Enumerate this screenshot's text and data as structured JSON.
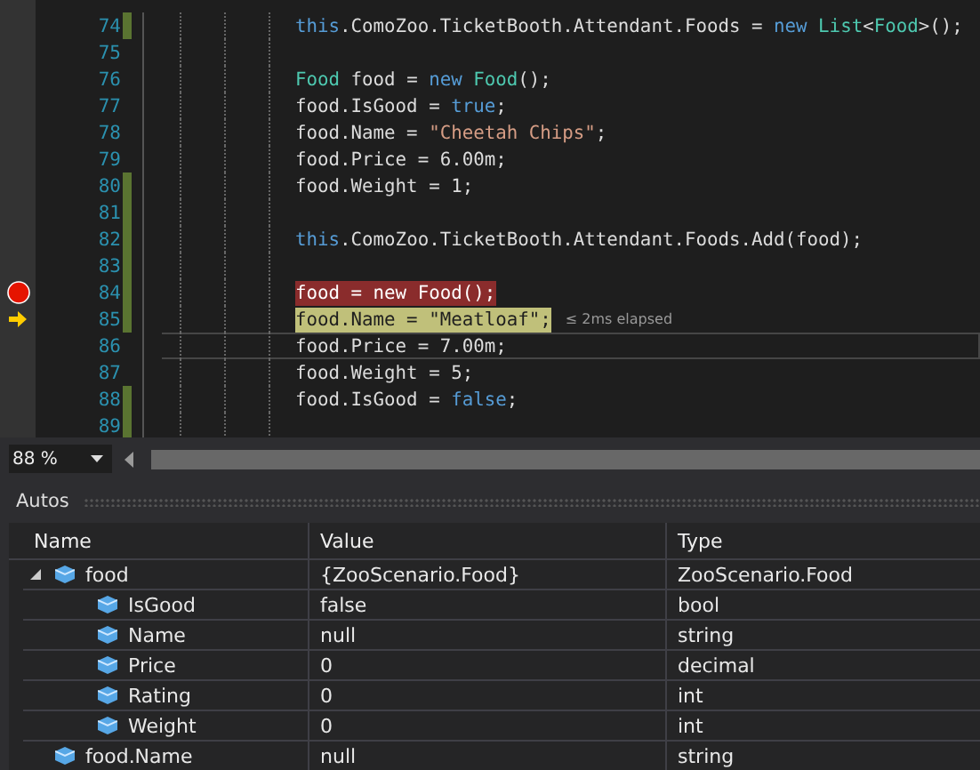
{
  "editor": {
    "lines": [
      {
        "number": "74",
        "changed": true,
        "kind": "normal",
        "tokens": [
          {
            "kind": "keyword",
            "text": "this"
          },
          {
            "kind": "plain",
            "text": ".ComoZoo.TicketBooth.Attendant.Foods = "
          },
          {
            "kind": "keyword",
            "text": "new"
          },
          {
            "kind": "type",
            "text": " List"
          },
          {
            "kind": "plain",
            "text": "<"
          },
          {
            "kind": "type",
            "text": "Food"
          },
          {
            "kind": "plain",
            "text": ">();"
          }
        ]
      },
      {
        "number": "75",
        "changed": false,
        "kind": "normal"
      },
      {
        "number": "76",
        "changed": false,
        "kind": "normal",
        "tokens": [
          {
            "kind": "type",
            "text": "Food"
          },
          {
            "kind": "plain",
            "text": " food = "
          },
          {
            "kind": "keyword",
            "text": "new"
          },
          {
            "kind": "type",
            "text": " Food"
          },
          {
            "kind": "plain",
            "text": "();"
          }
        ]
      },
      {
        "number": "77",
        "changed": false,
        "kind": "normal",
        "tokens": [
          {
            "kind": "plain",
            "text": "food.IsGood = "
          },
          {
            "kind": "keyword",
            "text": "true"
          },
          {
            "kind": "plain",
            "text": ";"
          }
        ]
      },
      {
        "number": "78",
        "changed": false,
        "kind": "normal",
        "tokens": [
          {
            "kind": "plain",
            "text": "food.Name = "
          },
          {
            "kind": "string",
            "text": "\"Cheetah Chips\""
          },
          {
            "kind": "plain",
            "text": ";"
          }
        ]
      },
      {
        "number": "79",
        "changed": false,
        "kind": "normal",
        "tokens": [
          {
            "kind": "plain",
            "text": "food.Price = 6.00m;"
          }
        ]
      },
      {
        "number": "80",
        "changed": true,
        "kind": "normal",
        "tokens": [
          {
            "kind": "plain",
            "text": "food.Weight = 1;"
          }
        ]
      },
      {
        "number": "81",
        "changed": true,
        "kind": "normal"
      },
      {
        "number": "82",
        "changed": true,
        "kind": "normal",
        "tokens": [
          {
            "kind": "keyword",
            "text": "this"
          },
          {
            "kind": "plain",
            "text": ".ComoZoo.TicketBooth.Attendant.Foods.Add(food);"
          }
        ]
      },
      {
        "number": "83",
        "changed": true,
        "kind": "normal"
      },
      {
        "number": "84",
        "changed": true,
        "kind": "breakpoint",
        "tokens": [
          {
            "kind": "plain",
            "text": "food = new Food();"
          }
        ]
      },
      {
        "number": "85",
        "changed": true,
        "kind": "current",
        "tokens": [
          {
            "kind": "plain",
            "text": "food.Name = \"Meatloaf\";"
          }
        ],
        "perf_tip": "≤ 2ms elapsed"
      },
      {
        "number": "86",
        "changed": false,
        "kind": "caret",
        "tokens": [
          {
            "kind": "plain",
            "text": "food.Price = 7.00m;"
          }
        ]
      },
      {
        "number": "87",
        "changed": false,
        "kind": "normal",
        "tokens": [
          {
            "kind": "plain",
            "text": "food.Weight = 5;"
          }
        ]
      },
      {
        "number": "88",
        "changed": true,
        "kind": "normal",
        "tokens": [
          {
            "kind": "plain",
            "text": "food.IsGood = "
          },
          {
            "kind": "keyword",
            "text": "false"
          },
          {
            "kind": "plain",
            "text": ";"
          }
        ]
      },
      {
        "number": "89",
        "changed": true,
        "kind": "normal"
      }
    ],
    "zoom": "88 %"
  },
  "autos": {
    "title": "Autos",
    "columns": [
      "Name",
      "Value",
      "Type"
    ],
    "rows": [
      {
        "name": "food",
        "value": "{ZooScenario.Food}",
        "type": "ZooScenario.Food",
        "expanded": true,
        "children": [
          {
            "name": "IsGood",
            "value": "false",
            "type": "bool"
          },
          {
            "name": "Name",
            "value": "null",
            "type": "string"
          },
          {
            "name": "Price",
            "value": "0",
            "type": "decimal"
          },
          {
            "name": "Rating",
            "value": "0",
            "type": "int"
          },
          {
            "name": "Weight",
            "value": "0",
            "type": "int"
          }
        ]
      },
      {
        "name": "food.Name",
        "value": "null",
        "type": "string"
      }
    ]
  }
}
